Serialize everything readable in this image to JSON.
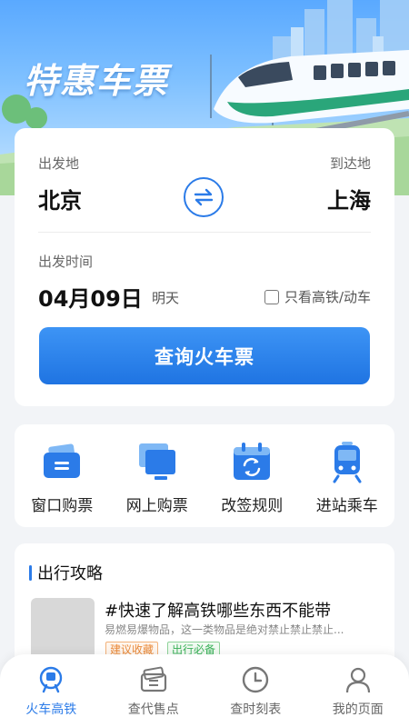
{
  "hero": {
    "title": "特惠车票"
  },
  "search": {
    "from_label": "出发地",
    "to_label": "到达地",
    "from_city": "北京",
    "to_city": "上海",
    "date_label": "出发时间",
    "date": "04月09日",
    "weekday": "明天",
    "highspeed_only": "只看高铁/动车",
    "query_button": "查询火车票"
  },
  "services": [
    {
      "label": "窗口购票",
      "icon": "ticket-window-icon"
    },
    {
      "label": "网上购票",
      "icon": "online-purchase-icon"
    },
    {
      "label": "改签规则",
      "icon": "reschedule-calendar-icon"
    },
    {
      "label": "进站乘车",
      "icon": "train-boarding-icon"
    }
  ],
  "guide": {
    "title": "出行攻略",
    "article_title": "#快速了解高铁哪些东西不能带",
    "article_desc": "易燃易爆物品，这一类物品是绝对禁止禁止禁止...",
    "tags": [
      "建议收藏",
      "出行必备"
    ]
  },
  "tabs": [
    {
      "label": "火车高铁",
      "icon": "train-icon",
      "active": true
    },
    {
      "label": "查代售点",
      "icon": "ticket-agent-icon",
      "active": false
    },
    {
      "label": "查时刻表",
      "icon": "clock-icon",
      "active": false
    },
    {
      "label": "我的页面",
      "icon": "user-icon",
      "active": false
    }
  ],
  "colors": {
    "accent": "#2b7be8",
    "hero_top": "#5aa9ff",
    "tag_orange": "#ea8a3a",
    "tag_green": "#3bb25a"
  }
}
